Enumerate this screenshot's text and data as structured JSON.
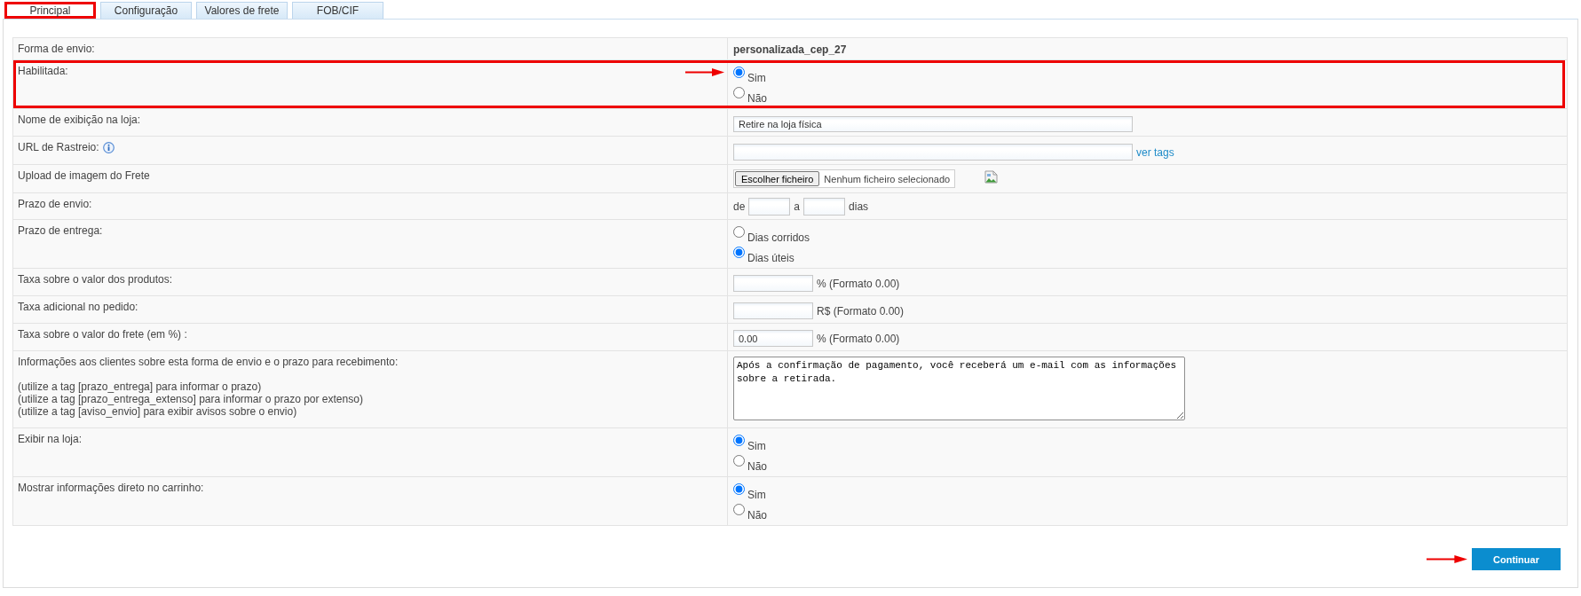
{
  "tabs": [
    {
      "label": "Principal",
      "selected": true,
      "highlighted": true
    },
    {
      "label": "Configuração",
      "selected": false,
      "highlighted": false
    },
    {
      "label": "Valores de frete",
      "selected": false,
      "highlighted": false
    },
    {
      "label": "FOB/CIF",
      "selected": false,
      "highlighted": false
    }
  ],
  "rows": [
    {
      "kind": "text",
      "label": "Forma de envio:",
      "value": "personalizada_cep_27",
      "highlighted": false
    },
    {
      "kind": "radio",
      "label": "Habilitada:",
      "highlighted": true,
      "options": [
        {
          "label": "Sim",
          "selected": true
        },
        {
          "label": "Não",
          "selected": false
        }
      ]
    },
    {
      "kind": "input",
      "label": "Nome de exibição na loja:",
      "value": "Retire na loja física",
      "highlighted": false
    },
    {
      "kind": "link_input",
      "label": "URL de Rastreio:",
      "link": "ver tags",
      "highlighted": false
    },
    {
      "kind": "file",
      "label": "Upload de imagem do Frete",
      "button": "Escolher ficheiro",
      "status": "Nenhum ficheiro selecionado",
      "highlighted": false
    },
    {
      "kind": "range",
      "label": "Prazo de envio:",
      "prefix": "de",
      "middle": "a",
      "suffix": "dias",
      "highlighted": false
    },
    {
      "kind": "radio",
      "label": "Prazo de entrega:",
      "highlighted": false,
      "options": [
        {
          "label": "Dias corridos",
          "selected": false
        },
        {
          "label": "Dias úteis",
          "selected": true
        }
      ]
    },
    {
      "kind": "unit_input",
      "label": "Taxa sobre o valor dos produtos:",
      "unit": "% (Formato 0.00)",
      "highlighted": false
    },
    {
      "kind": "unit_input",
      "label": "Taxa adicional no pedido:",
      "unit": "R$ (Formato 0.00)",
      "highlighted": false
    },
    {
      "kind": "unit_input",
      "label": "Taxa sobre o valor do frete (em %) :",
      "value": "0.00",
      "unit": "% (Formato 0.00)",
      "highlighted": false
    },
    {
      "kind": "textarea",
      "label": "Informações aos clientes sobre esta forma de envio e o prazo para recebimento:",
      "notes": [
        "(utilize a tag [prazo_entrega] para informar o prazo)",
        "(utilize a tag [prazo_entrega_extenso] para informar o prazo por extenso)",
        "(utilize a tag [aviso_envio] para exibir avisos sobre o envio)"
      ],
      "value": "Após a confirmação de pagamento, você receberá um e-mail com as informações sobre a retirada.",
      "highlighted": false
    },
    {
      "kind": "radio",
      "label": "Exibir na loja:",
      "highlighted": false,
      "options": [
        {
          "label": "Sim",
          "selected": true
        },
        {
          "label": "Não",
          "selected": false
        }
      ]
    },
    {
      "kind": "radio",
      "label": "Mostrar informações direto no carrinho:",
      "highlighted": false,
      "options": [
        {
          "label": "Sim",
          "selected": true
        },
        {
          "label": "Não",
          "selected": false
        }
      ]
    }
  ],
  "button": {
    "label": "Continuar",
    "highlighted": true
  }
}
